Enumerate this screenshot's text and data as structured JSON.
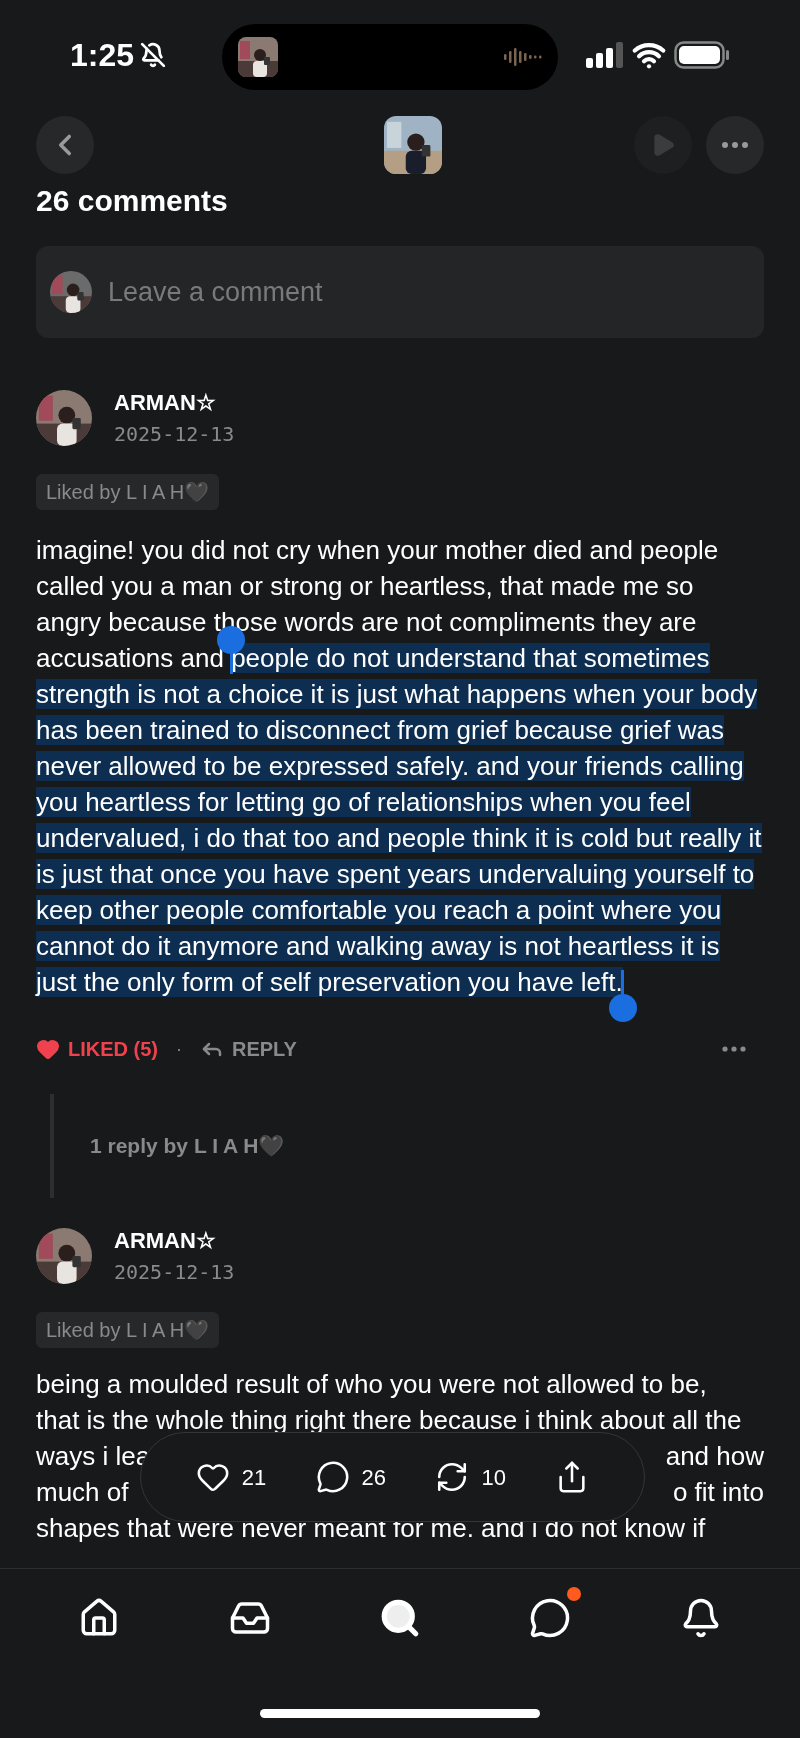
{
  "status_bar": {
    "time": "1:25",
    "silent": true
  },
  "nav": {
    "play_disabled": true
  },
  "heading": "26 comments",
  "comment_field": {
    "placeholder": "Leave a comment"
  },
  "comments": [
    {
      "author": "ARMAN☆",
      "date": "2025-12-13",
      "liked_by": "Liked by L I A H🖤",
      "segments": [
        {
          "text": "imagine! you did not cry when your mother died and people called you a man or strong or heartless, that made me so angry because those words are not compliments they are accusations and ",
          "selected": false
        },
        {
          "text": "people do not understand that sometimes strength is not a choice it is just what happens when your body has been trained to disconnect from grief because grief was never allowed to be expressed safely. and your friends calling you heartless for letting go of relationships when you feel undervalued, i do that too and people think it is cold but really it is just that once you have spent years undervaluing yourself to keep other people comfortable you reach a point where you cannot do it anymore and walking away is not heartless it is just the only form of self preservation you have left.",
          "selected": true
        }
      ],
      "like": {
        "label": "LIKED (5)",
        "liked": true
      },
      "separator": "·",
      "reply_label": "REPLY",
      "thread": "1 reply by L I A H🖤"
    },
    {
      "author": "ARMAN☆",
      "date": "2025-12-13",
      "liked_by": "Liked by L I A H🖤",
      "lines": [
        {
          "left": "being a moulded result of who you were not allowed to be,"
        },
        {
          "left": "that is the whole thing right there because i think about all the"
        },
        {
          "left": "ways i lea",
          "right": "and how"
        },
        {
          "left": "much of",
          "right": "o fit into"
        },
        {
          "left": "shapes that were never meant for me. and i do not know if"
        }
      ]
    }
  ],
  "action_bar": [
    {
      "kind": "like",
      "count": "21"
    },
    {
      "kind": "comment",
      "count": "26"
    },
    {
      "kind": "repost",
      "count": "10"
    },
    {
      "kind": "share"
    }
  ],
  "tab_bar": [
    {
      "kind": "home",
      "selected": false,
      "unread": false
    },
    {
      "kind": "inbox",
      "selected": false,
      "unread": false
    },
    {
      "kind": "search",
      "selected": true,
      "unread": false
    },
    {
      "kind": "messages",
      "selected": false,
      "unread": true
    },
    {
      "kind": "notifications",
      "selected": false,
      "unread": false
    }
  ]
}
